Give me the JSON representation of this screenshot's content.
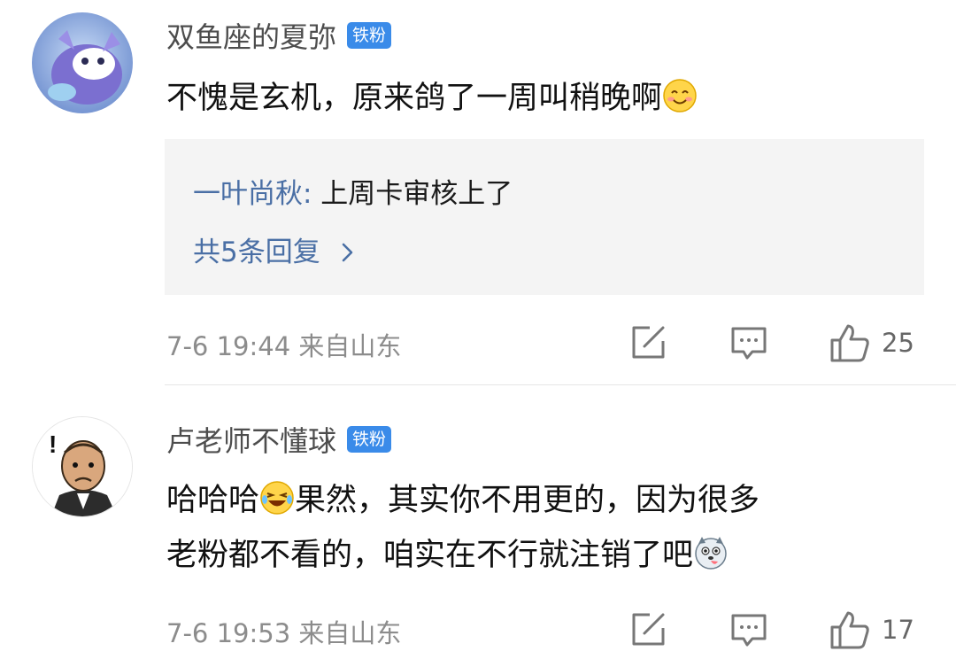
{
  "comments": [
    {
      "username": "双鱼座的夏弥",
      "badge": "铁粉",
      "content": "不愧是玄机，原来鸽了一周叫稍晚啊",
      "content_emoji": "smile-emoji",
      "reply": {
        "author": "一叶尚秋",
        "separator": ":",
        "text": " 上周卡审核上了",
        "more": "共5条回复"
      },
      "meta": "7-6 19:44 来自山东",
      "likes": "25"
    },
    {
      "username": "卢老师不懂球",
      "badge": "铁粉",
      "content_line1_a": "哈哈哈",
      "content_line1_b": "果然，其实你不用更的，因为很多",
      "content_line2": "老粉都不看的，咱实在不行就注销了吧",
      "meta": "7-6 19:53 来自山东",
      "likes": "17"
    }
  ],
  "icons": {
    "share": "share-icon",
    "comment": "comment-icon",
    "like": "thumbs-up-icon",
    "chevron": "chevron-right-icon"
  },
  "colors": {
    "badge": "#3a8be9",
    "reply_author": "#4a6fa5",
    "meta": "#8c8c8c"
  }
}
